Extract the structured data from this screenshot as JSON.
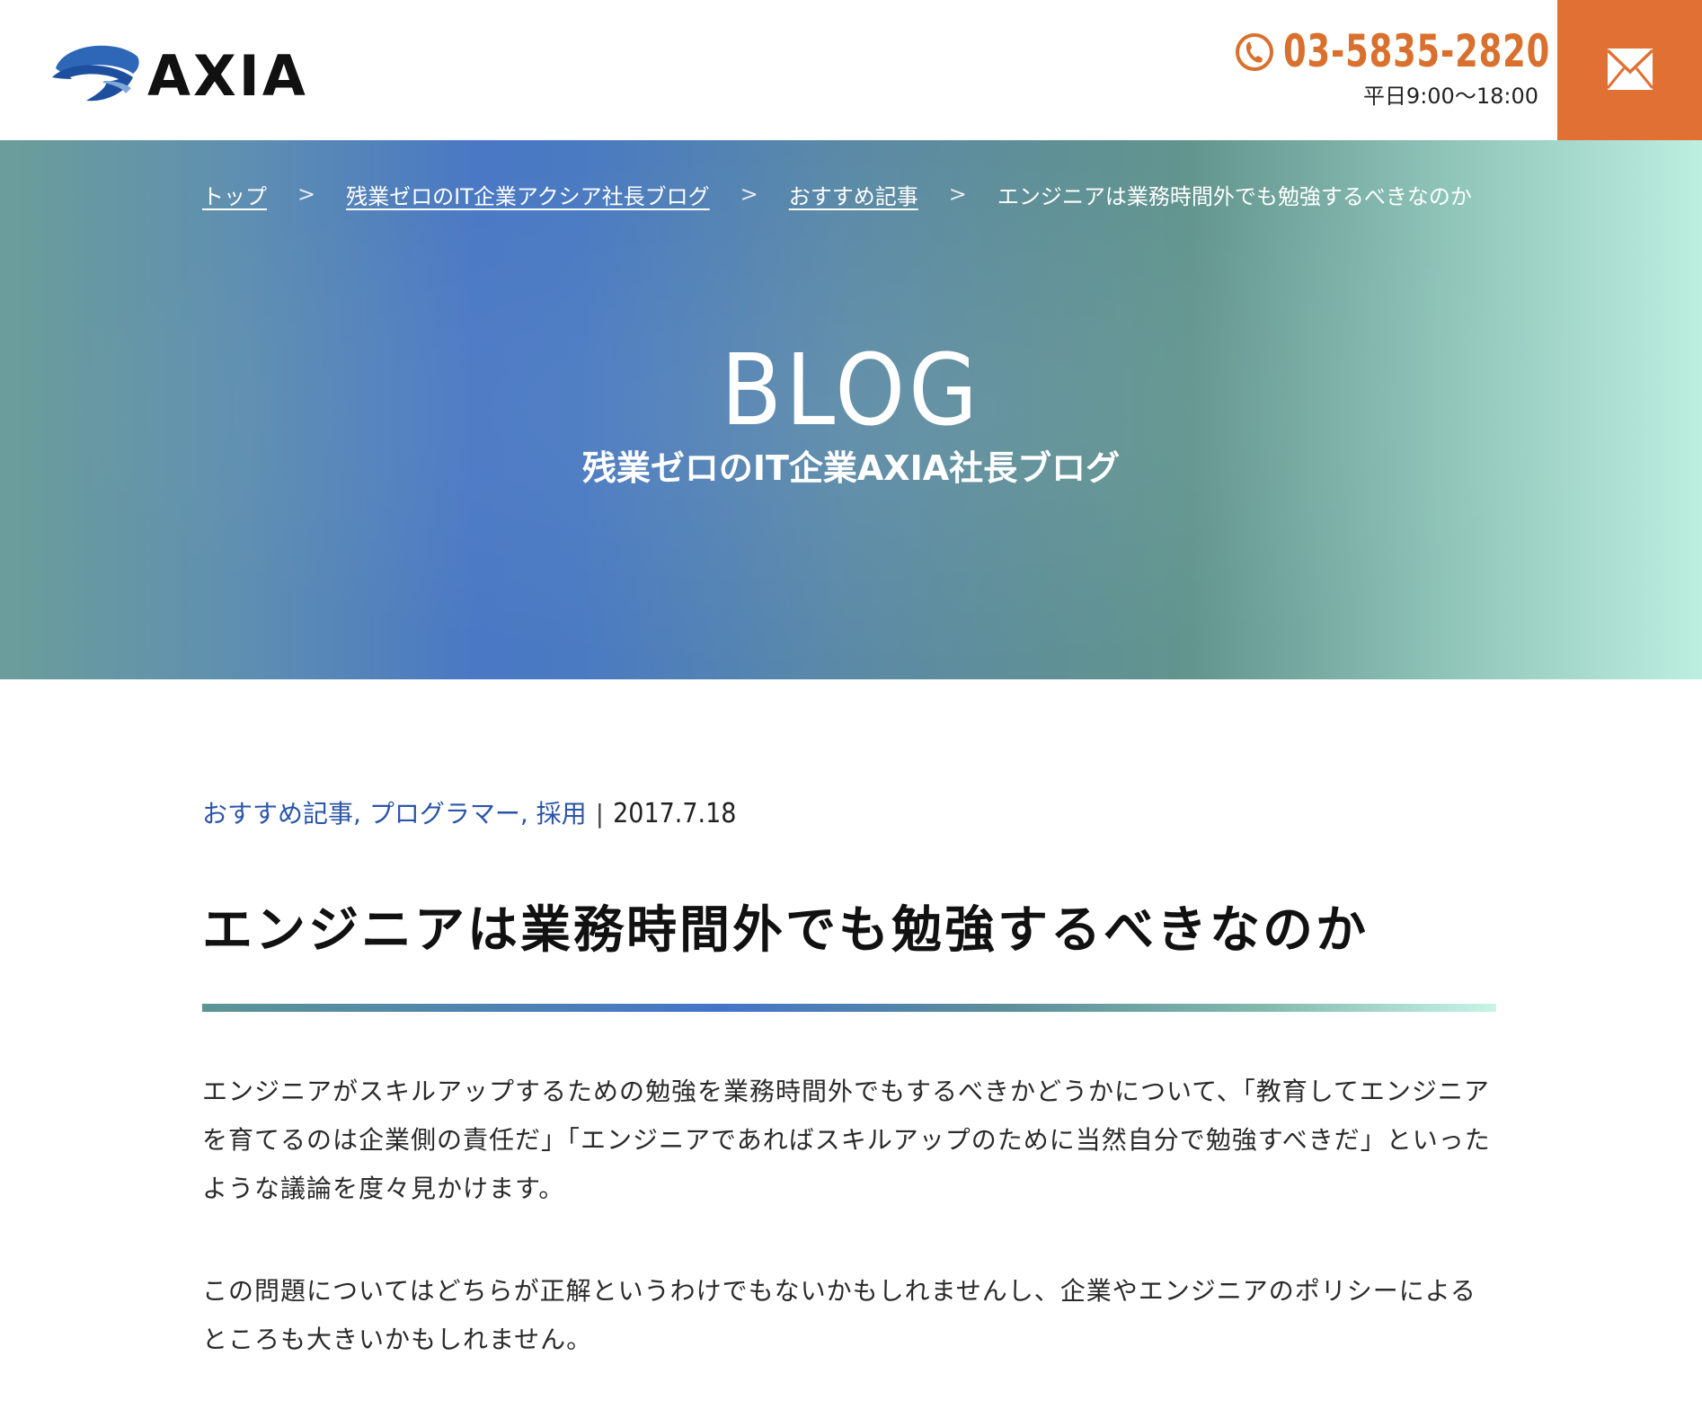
{
  "header": {
    "logo_text": "AXIA",
    "phone": "03-5835-2820",
    "hours": "平日9:00〜18:00",
    "accent_color": "#e07034"
  },
  "breadcrumb": {
    "items": [
      "トップ",
      "残業ゼロのIT企業アクシア社長ブログ",
      "おすすめ記事"
    ],
    "separator": ">",
    "current": "エンジニアは業務時間外でも勉強するべきなのか"
  },
  "hero": {
    "title": "BLOG",
    "subtitle": "残業ゼロのIT企業AXIA社長ブログ"
  },
  "article": {
    "categories": [
      "おすすめ記事",
      "プログラマー",
      "採用"
    ],
    "date": "2017.7.18",
    "title": "エンジニアは業務時間外でも勉強するべきなのか",
    "paragraphs": [
      "エンジニアがスキルアップするための勉強を業務時間外でもするべきかどうかについて、「教育してエンジニアを育てるのは企業側の責任だ」「エンジニアであればスキルアップのために当然自分で勉強すべきだ」といったような議論を度々見かけます。",
      "この問題についてはどちらが正解というわけでもないかもしれませんし、企業やエンジニアのポリシーによるところも大きいかもしれません。"
    ]
  },
  "icons": {
    "logo": "axia-logo-icon",
    "phone": "phone-icon",
    "mail": "mail-icon"
  }
}
